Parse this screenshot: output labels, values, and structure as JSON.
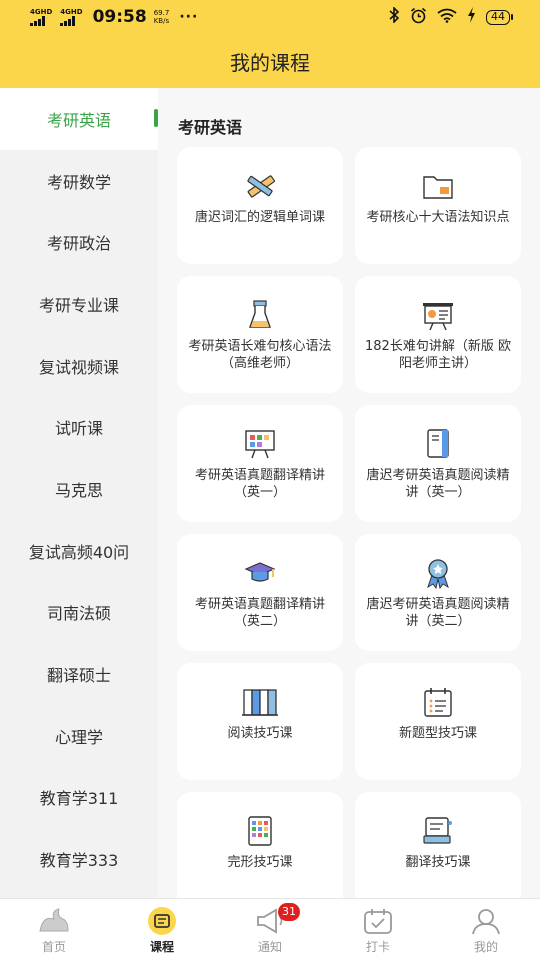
{
  "status_bar": {
    "signal1": "4GHD",
    "signal2": "4GHD",
    "time": "09:58",
    "speed_value": "69.7",
    "speed_unit": "KB/s",
    "more": "···",
    "battery": "44",
    "icons": [
      "bluetooth-icon",
      "alarm-icon",
      "wifi-icon",
      "charging-icon"
    ]
  },
  "header": {
    "title": "我的课程"
  },
  "sidebar": {
    "items": [
      {
        "label": "考研英语",
        "active": true
      },
      {
        "label": "考研数学"
      },
      {
        "label": "考研政治"
      },
      {
        "label": "考研专业课"
      },
      {
        "label": "复试视频课"
      },
      {
        "label": "试听课"
      },
      {
        "label": "马克思"
      },
      {
        "label": "复试高频40问"
      },
      {
        "label": "司南法硕"
      },
      {
        "label": "翻译硕士"
      },
      {
        "label": "心理学"
      },
      {
        "label": "教育学311"
      },
      {
        "label": "教育学333"
      }
    ]
  },
  "main": {
    "section_title": "考研英语",
    "courses": [
      {
        "label": "唐迟词汇的逻辑单词课",
        "icon": "pencil-ruler-icon"
      },
      {
        "label": "考研核心十大语法知识点",
        "icon": "folder-icon"
      },
      {
        "label": "考研英语长难句核心语法（高维老师）",
        "icon": "beaker-icon"
      },
      {
        "label": "182长难句讲解（新版 欧阳老师主讲）",
        "icon": "presentation-board-icon"
      },
      {
        "label": "考研英语真题翻译精讲（英一）",
        "icon": "whiteboard-icon"
      },
      {
        "label": "唐迟考研英语真题阅读精讲（英一）",
        "icon": "notebook-icon"
      },
      {
        "label": "考研英语真题翻译精讲（英二）",
        "icon": "graduation-cap-icon"
      },
      {
        "label": "唐迟考研英语真题阅读精讲（英二）",
        "icon": "award-medal-icon"
      },
      {
        "label": "阅读技巧课",
        "icon": "books-icon"
      },
      {
        "label": "新题型技巧课",
        "icon": "calendar-list-icon"
      },
      {
        "label": "完形技巧课",
        "icon": "tablet-grid-icon"
      },
      {
        "label": "翻译技巧课",
        "icon": "certificate-icon"
      }
    ]
  },
  "tabbar": {
    "tabs": [
      {
        "label": "首页",
        "icon": "home-bird-icon"
      },
      {
        "label": "课程",
        "icon": "course-icon",
        "active": true
      },
      {
        "label": "通知",
        "icon": "megaphone-icon",
        "badge": "31"
      },
      {
        "label": "打卡",
        "icon": "checkin-icon"
      },
      {
        "label": "我的",
        "icon": "profile-icon"
      }
    ]
  },
  "colors": {
    "accent_yellow": "#fcd64a",
    "active_green": "#3aa34a",
    "badge_red": "#e02020"
  }
}
